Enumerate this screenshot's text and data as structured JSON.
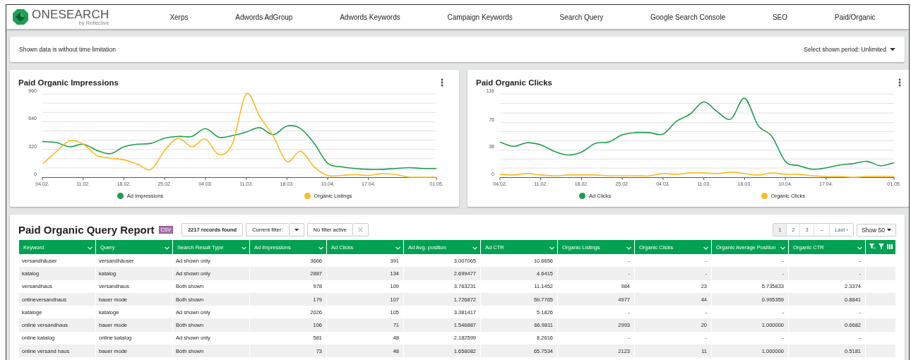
{
  "brand": {
    "name": "ONESEARCH",
    "tagline": "by Reflective"
  },
  "nav": [
    {
      "label": "Xerps"
    },
    {
      "label": "Adwords AdGroup"
    },
    {
      "label": "Adwords Keywords"
    },
    {
      "label": "Campaign Keywords"
    },
    {
      "label": "Search Query"
    },
    {
      "label": "Google Search Console"
    },
    {
      "label": "SEO"
    },
    {
      "label": "Paid/Organic"
    }
  ],
  "info_bar": {
    "text": "Shown data is without time limitation",
    "period_label": "Select shown period: Unlimited"
  },
  "charts": [
    {
      "title": "Paid Organic Impressions",
      "chart_data": {
        "type": "line",
        "categories": [
          "04.02.",
          null,
          null,
          "11.02.",
          null,
          null,
          "18.02.",
          null,
          null,
          "25.02.",
          null,
          null,
          "04.03.",
          null,
          null,
          "11.03.",
          null,
          null,
          "18.03.",
          null,
          null,
          "10.04.",
          null,
          null,
          "17.04.",
          null,
          null,
          null,
          null,
          "01.05."
        ],
        "ylim": [
          0,
          960
        ],
        "yticks": [
          0,
          320,
          640,
          960
        ],
        "grid": true,
        "series": [
          {
            "name": "Ad Impressions",
            "color": "#1e9e4e",
            "values": [
              410,
              400,
              350,
              380,
              310,
              270,
              350,
              380,
              390,
              450,
              470,
              470,
              560,
              460,
              480,
              520,
              570,
              490,
              590,
              560,
              390,
              160,
              120,
              100,
              90,
              90,
              100,
              110,
              100,
              100
            ]
          },
          {
            "name": "Organic Listings",
            "color": "#fbbc1e",
            "values": [
              150,
              290,
              420,
              380,
              250,
              220,
              200,
              150,
              90,
              310,
              450,
              350,
              440,
              260,
              390,
              960,
              700,
              470,
              180,
              300,
              120,
              20,
              20,
              30,
              20,
              40,
              30,
              0,
              0,
              0
            ]
          }
        ]
      }
    },
    {
      "title": "Paid Organic Clicks",
      "chart_data": {
        "type": "line",
        "categories": [
          "04.02.",
          null,
          null,
          "11.02.",
          null,
          null,
          "18.02.",
          null,
          null,
          "25.02.",
          null,
          null,
          "04.03.",
          null,
          null,
          "11.03.",
          null,
          null,
          "18.03.",
          null,
          null,
          "10.04.",
          null,
          null,
          "17.04.",
          null,
          null,
          null,
          null,
          "01.05."
        ],
        "ylim": [
          0,
          116
        ],
        "yticks": [
          0,
          38,
          76,
          116
        ],
        "grid": true,
        "series": [
          {
            "name": "Ad Clicks",
            "color": "#1e9e4e",
            "values": [
              49,
              43,
              48,
              45,
              36,
              31,
              35,
              47,
              49,
              59,
              62,
              62,
              60,
              78,
              88,
              105,
              91,
              81,
              110,
              72,
              57,
              22,
              16,
              11,
              13,
              17,
              19,
              22,
              16,
              20
            ]
          },
          {
            "name": "Organic Clicks",
            "color": "#fbbc1e",
            "values": [
              4,
              3,
              5,
              3,
              2,
              3,
              3,
              3,
              2,
              2,
              2,
              2,
              5,
              4,
              6,
              6,
              5,
              7,
              5,
              3,
              6,
              4,
              4,
              2,
              1,
              1,
              0,
              1,
              1,
              1
            ]
          }
        ]
      }
    }
  ],
  "report": {
    "title": "Paid Organic Query Report",
    "csv_label": "CSV",
    "records": "2217 records found",
    "filter_label": "Current filter:",
    "filter_value": "No filter active",
    "pages": [
      {
        "label": "1",
        "selected": true
      },
      {
        "label": "2",
        "selected": false
      },
      {
        "label": "3",
        "selected": false
      },
      {
        "label": "→",
        "selected": false
      },
      {
        "label": "Last ›",
        "selected": false
      }
    ],
    "show": "Show 50",
    "columns": [
      {
        "label": "Keyword",
        "kind": "text"
      },
      {
        "label": "Query",
        "kind": "text"
      },
      {
        "label": "Search Result Type",
        "kind": "text"
      },
      {
        "label": "Ad Impressions",
        "kind": "number"
      },
      {
        "label": "Ad Clicks",
        "kind": "number"
      },
      {
        "label": "Ad Avg. position",
        "kind": "number"
      },
      {
        "label": "Ad CTR",
        "kind": "number"
      },
      {
        "label": "Organic Listings",
        "kind": "number"
      },
      {
        "label": "Organic Clicks",
        "kind": "number"
      },
      {
        "label": "Organic Average Position",
        "kind": "number"
      },
      {
        "label": "Organic CTR",
        "kind": "number"
      }
    ],
    "rows": [
      [
        "versandhäuser",
        "versandhäuser",
        "Ad shown only",
        "3666",
        "391",
        "3.007065",
        "10.6656",
        "-",
        "-",
        "-",
        "-"
      ],
      [
        "katalog",
        "katalog",
        "Ad shown only",
        "2887",
        "134",
        "2.699477",
        "4.6415",
        "-",
        "-",
        "-",
        "-"
      ],
      [
        "versandhaus",
        "versandhaus",
        "Both shown",
        "978",
        "109",
        "3.763231",
        "11.1452",
        "984",
        "23",
        "5.735833",
        "2.3374"
      ],
      [
        "onlineversandhaus",
        "bauer mode",
        "Both shown",
        "179",
        "107",
        "1.726872",
        "59.7765",
        "4977",
        "44",
        "0.995359",
        "0.8841"
      ],
      [
        "kataloge",
        "kataloge",
        "Ad shown only",
        "2026",
        "105",
        "3.381417",
        "5.1826",
        "-",
        "-",
        "-",
        "-"
      ],
      [
        "online versandhaus",
        "bauer mode",
        "Both shown",
        "106",
        "71",
        "1.546887",
        "66.9811",
        "2993",
        "20",
        "1.000000",
        "0.6682"
      ],
      [
        "online katalog",
        "online katalog",
        "Ad shown only",
        "581",
        "48",
        "2.182599",
        "8.2616",
        "-",
        "-",
        "-",
        "-"
      ],
      [
        "online versand haus",
        "bauer mode",
        "Both shown",
        "73",
        "48",
        "1.658082",
        "65.7534",
        "2123",
        "11",
        "1.000000",
        "0.5181"
      ]
    ]
  }
}
